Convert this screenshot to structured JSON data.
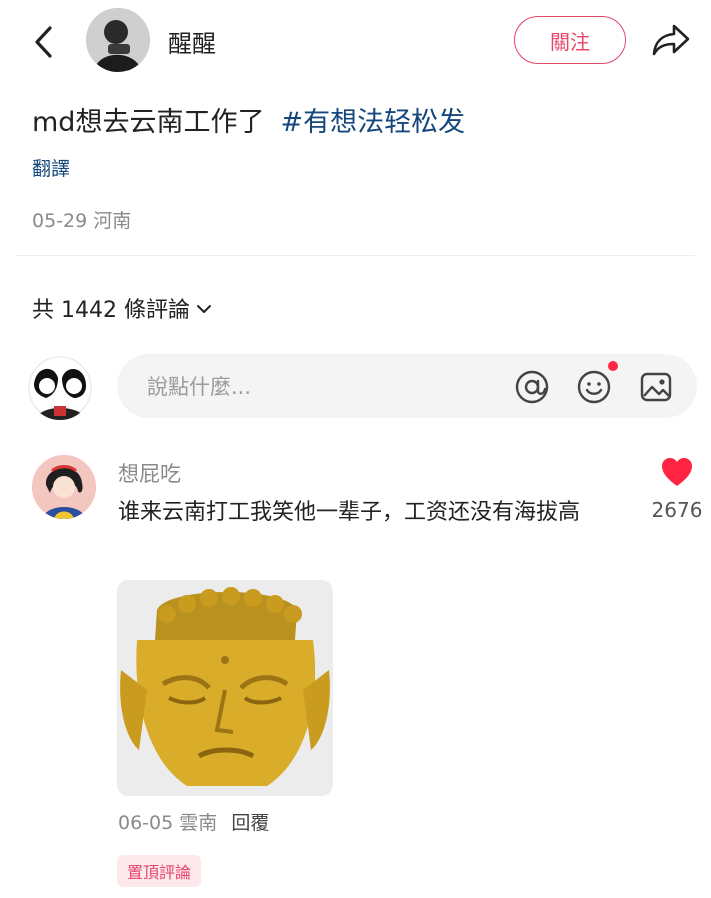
{
  "header": {
    "username": "醒醒",
    "follow_label": "關注"
  },
  "post": {
    "text": "md想去云南工作了",
    "hashtag": "#有想法轻松发",
    "translate_label": "翻譯",
    "date": "05-29",
    "location": "河南"
  },
  "comments_section": {
    "count_label": "共 1442 條評論"
  },
  "input": {
    "placeholder": "說點什麼..."
  },
  "comment": {
    "username": "想屁吃",
    "text": "谁来云南打工我笑他一辈子，工资还没有海拔高",
    "likes": "2676",
    "date": "06-05",
    "location": "雲南",
    "reply_label": "回覆",
    "pinned_label": "置頂評論"
  },
  "colors": {
    "accent": "#e8456a",
    "hashtag": "#16477c",
    "heart": "#ff2442"
  },
  "icons": [
    "back-arrow-icon",
    "share-icon",
    "chevron-down-icon",
    "at-icon",
    "emoji-icon",
    "image-icon",
    "heart-icon"
  ]
}
